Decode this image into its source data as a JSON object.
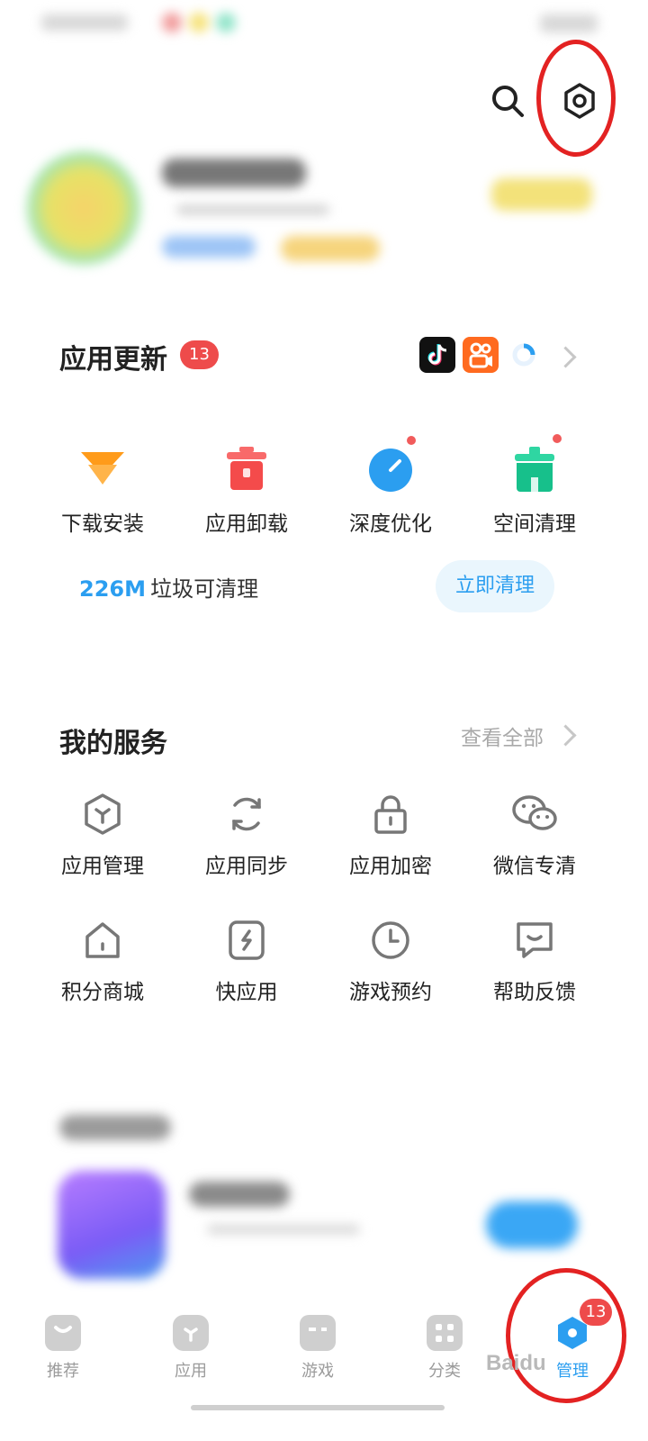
{
  "accent_color": "#2b9ef0",
  "alert_color": "#ee4b4b",
  "annotation_color": "#e32222",
  "top_actions": {
    "search_icon": "search-icon",
    "settings_icon": "settings-icon"
  },
  "app_updates": {
    "title": "应用更新",
    "badge": "13",
    "app_icons": [
      "douyin-app-icon",
      "kuaishou-app-icon",
      "loading-app-icon"
    ]
  },
  "tools": [
    {
      "label": "下载安装",
      "icon": "download-icon"
    },
    {
      "label": "应用卸载",
      "icon": "trash-icon"
    },
    {
      "label": "深度优化",
      "icon": "gauge-icon"
    },
    {
      "label": "空间清理",
      "icon": "broom-icon"
    }
  ],
  "cleanup": {
    "value": "226M",
    "text": "垃圾可清理",
    "button": "立即清理"
  },
  "my_services": {
    "title": "我的服务",
    "view_all": "查看全部",
    "items": [
      {
        "label": "应用管理",
        "icon": "app-manage-icon"
      },
      {
        "label": "应用同步",
        "icon": "sync-icon"
      },
      {
        "label": "应用加密",
        "icon": "lock-icon"
      },
      {
        "label": "微信专清",
        "icon": "wechat-icon"
      },
      {
        "label": "积分商城",
        "icon": "store-icon"
      },
      {
        "label": "快应用",
        "icon": "quick-app-icon"
      },
      {
        "label": "游戏预约",
        "icon": "clock-icon"
      },
      {
        "label": "帮助反馈",
        "icon": "feedback-icon"
      }
    ]
  },
  "bottom_nav": {
    "items": [
      {
        "label": "推荐",
        "icon": "recommend-icon"
      },
      {
        "label": "应用",
        "icon": "apps-icon"
      },
      {
        "label": "游戏",
        "icon": "gamepad-icon"
      },
      {
        "label": "分类",
        "icon": "category-icon"
      },
      {
        "label": "管理",
        "icon": "manage-icon",
        "active": true
      }
    ],
    "badge": "13"
  },
  "watermark": "Baidu"
}
